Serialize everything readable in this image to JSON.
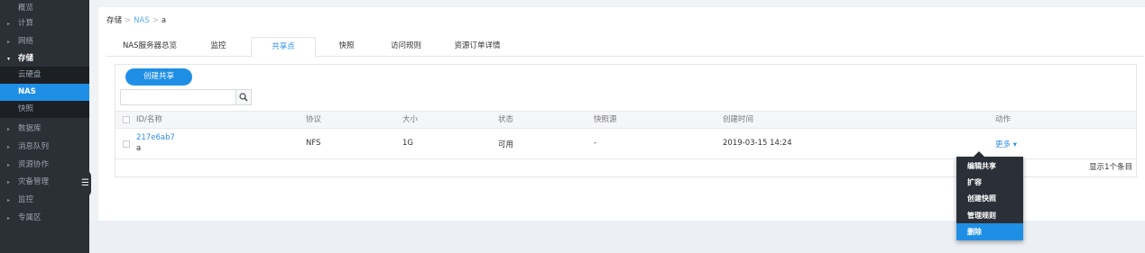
{
  "sidebar": {
    "items": [
      {
        "label": "概览",
        "arrow": ""
      },
      {
        "label": "计算",
        "arrow": "▸"
      },
      {
        "label": "网络",
        "arrow": "▸"
      },
      {
        "label": "存储",
        "arrow": "▾"
      },
      {
        "label": "云硬盘",
        "arrow": ""
      },
      {
        "label": "NAS",
        "arrow": ""
      },
      {
        "label": "快照",
        "arrow": ""
      },
      {
        "label": "数据库",
        "arrow": "▸"
      },
      {
        "label": "消息队列",
        "arrow": "▸"
      },
      {
        "label": "资源协作",
        "arrow": "▸"
      },
      {
        "label": "灾备管理",
        "arrow": "▸"
      },
      {
        "label": "监控",
        "arrow": "▸"
      },
      {
        "label": "专属区",
        "arrow": "▸"
      }
    ],
    "collapse_glyph": "☰"
  },
  "breadcrumb": {
    "root": "存储",
    "sep": ">",
    "mid": "NAS",
    "leaf": "a"
  },
  "tabs": [
    {
      "label": "NAS服务器总览"
    },
    {
      "label": "监控"
    },
    {
      "label": "共享点"
    },
    {
      "label": "快照"
    },
    {
      "label": "访问规则"
    },
    {
      "label": "资源订单详情"
    }
  ],
  "toolbar": {
    "create_label": "创建共享",
    "search_placeholder": "",
    "search_icon": "🔍"
  },
  "table": {
    "headers": [
      "ID/名称",
      "协议",
      "大小",
      "状态",
      "快照源",
      "创建时间",
      "动作"
    ],
    "rows": [
      {
        "id": "217e6ab7",
        "name": "a",
        "protocol": "NFS",
        "size": "1G",
        "status": "可用",
        "snapshot_source": "-",
        "created": "2019-03-15 14:24",
        "action": "更多",
        "action_caret": "▾"
      }
    ],
    "footer": "显示1个条目"
  },
  "dropdown": {
    "items": [
      "编辑共享",
      "扩容",
      "创建快照",
      "管理规则",
      "删除"
    ]
  },
  "colors": {
    "accent": "#1f8fe6",
    "sidebar_bg": "#2b2f36"
  }
}
